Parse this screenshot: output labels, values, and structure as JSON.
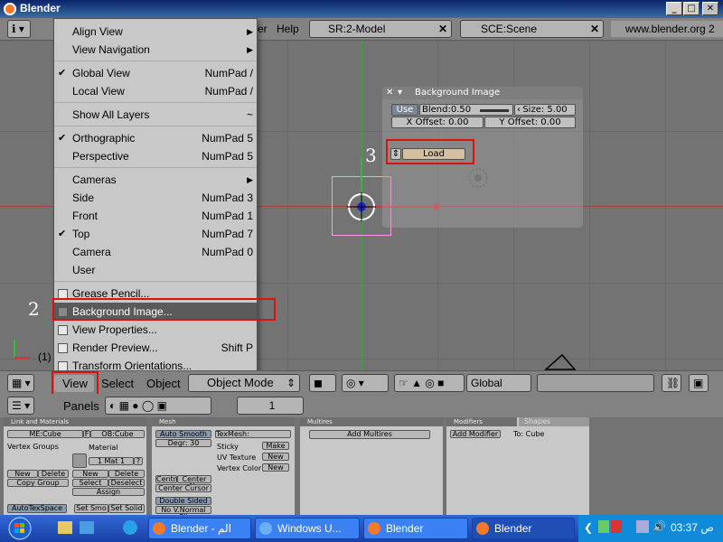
{
  "window": {
    "title": "Blender"
  },
  "header": {
    "menu_help": "Help",
    "menu_r_fragment": "er",
    "screen": "SR:2-Model",
    "scene": "SCE:Scene",
    "url": "www.blender.org 2"
  },
  "view_menu": {
    "items": [
      {
        "label": "Align View",
        "shortcut": "",
        "submenu": true,
        "check": "none"
      },
      {
        "label": "View Navigation",
        "shortcut": "",
        "submenu": true,
        "check": "none"
      },
      {
        "label": "Global View",
        "shortcut": "NumPad /",
        "check": "tick"
      },
      {
        "label": "Local View",
        "shortcut": "NumPad /",
        "check": "none"
      },
      {
        "label": "Show All Layers",
        "shortcut": "~",
        "check": "none"
      },
      {
        "label": "Orthographic",
        "shortcut": "NumPad 5",
        "check": "tick"
      },
      {
        "label": "Perspective",
        "shortcut": "NumPad 5",
        "check": "none"
      },
      {
        "label": "Cameras",
        "shortcut": "",
        "submenu": true,
        "check": "none"
      },
      {
        "label": "Side",
        "shortcut": "NumPad 3",
        "check": "none"
      },
      {
        "label": "Front",
        "shortcut": "NumPad 1",
        "check": "none"
      },
      {
        "label": "Top",
        "shortcut": "NumPad 7",
        "check": "tick"
      },
      {
        "label": "Camera",
        "shortcut": "NumPad 0",
        "check": "none"
      },
      {
        "label": "User",
        "shortcut": "",
        "check": "none"
      },
      {
        "label": "Grease Pencil...",
        "shortcut": "",
        "check": "box"
      },
      {
        "label": "Background Image...",
        "shortcut": "",
        "check": "box",
        "highlighted": true
      },
      {
        "label": "View Properties...",
        "shortcut": "",
        "check": "box"
      },
      {
        "label": "Render Preview...",
        "shortcut": "Shift P",
        "check": "box"
      },
      {
        "label": "Transform Orientations...",
        "shortcut": "",
        "check": "box"
      }
    ]
  },
  "bg_panel": {
    "title": "Background Image",
    "use": "Use",
    "blend": "Blend:0.50",
    "size": "Size: 5.00",
    "x_offset": "X Offset: 0.00",
    "y_offset": "Y Offset: 0.00",
    "load": "Load"
  },
  "annotations": {
    "step2": "2",
    "step3": "3"
  },
  "viewport": {
    "frame_label": "(1)"
  },
  "view_header": {
    "view": "View",
    "select": "Select",
    "object": "Object",
    "mode": "Object Mode",
    "orientation": "Global"
  },
  "buttons_window": {
    "panels_label": "Panels",
    "frame": "1",
    "link_title": "Link and Materials",
    "me_cube": "ME:Cube",
    "f": "F",
    "ob_cube": "OB:Cube",
    "vertex_groups": "Vertex Groups",
    "material": "Material",
    "mat_slot": "1 Mat 1",
    "q": "?",
    "new": "New",
    "delete": "Delete",
    "copy_group": "Copy Group",
    "select": "Select",
    "deselect": "Deselect",
    "assign": "Assign",
    "autotexspace": "AutoTexSpace",
    "set_smo": "Set Smo",
    "set_solid": "Set Solid",
    "mesh_title": "Mesh",
    "auto_smooth": "Auto Smooth",
    "degr": "Degr: 30",
    "centre_new": "Centre",
    "center_new": "Center Ne",
    "center_cursor": "Center Cursor",
    "double_sided": "Double Sided",
    "no_vnormal": "No V.Normal Fli",
    "texmesh": "TexMesh:",
    "sticky": "Sticky",
    "uv_texture": "UV Texture",
    "vertex_color": "Vertex Color",
    "make": "Make",
    "multires_title": "Multires",
    "add_multires": "Add Multires",
    "modifiers_tab": "Modifiers",
    "shapes_tab": "Shapes",
    "add_modifier": "Add Modifier",
    "to_cube": "To: Cube"
  },
  "taskbar": {
    "tasks": [
      "Blender - الم",
      "Windows U...",
      "Blender",
      "Blender"
    ],
    "clock": "ص 03:37"
  },
  "colors": {
    "highlight_red": "#e01010",
    "menu_bg": "#c8c8c8",
    "viewport_bg": "#737373"
  }
}
